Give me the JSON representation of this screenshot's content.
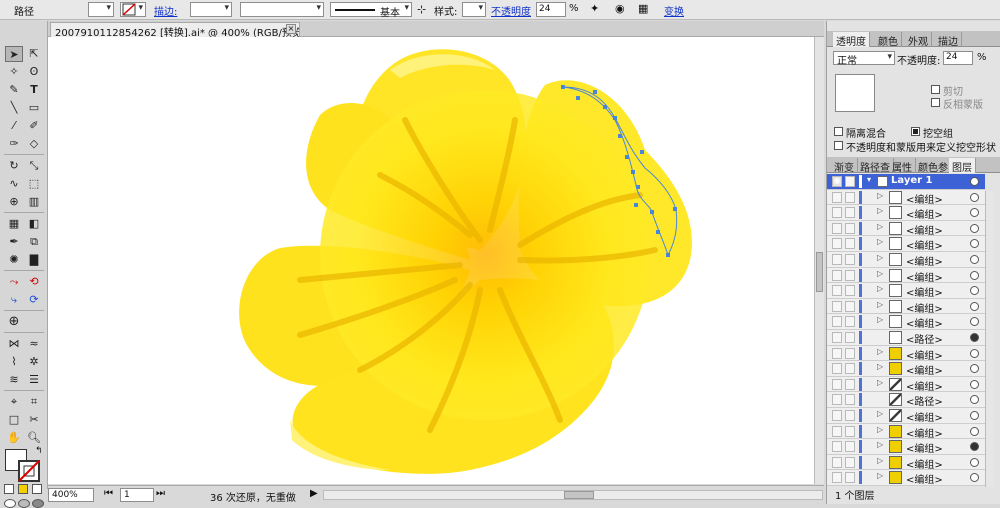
{
  "control_bar": {
    "object_type": "路径",
    "stroke_label": "描边:",
    "stroke_style_label": "基本",
    "style_label": "样式:",
    "opacity_label": "不透明度",
    "opacity_value": "24",
    "percent": "%",
    "transform_label": "变换"
  },
  "document_tab": {
    "title": "2007910112854262 [转换].ai* @ 400% (RGB/预览)",
    "close": "×"
  },
  "status_bar": {
    "zoom": "400%",
    "page": "1",
    "history": "36 次还原，无重做"
  },
  "transparency_panel": {
    "tabs": [
      "透明度",
      "颜色",
      "外观",
      "描边"
    ],
    "blend_mode": "正常",
    "opacity_label": "不透明度:",
    "opacity_value": "24",
    "percent": "%",
    "clip_label": "剪切",
    "invert_mask_label": "反相蒙版",
    "isolate_blending_label": "隔离混合",
    "knockout_group_label": "挖空组",
    "opacity_mask_define_label": "不透明度和蒙版用来定义挖空形状"
  },
  "layers_panel": {
    "tabs": [
      "渐变",
      "路径查",
      "属性",
      "颜色参",
      "图层"
    ],
    "layer_name": "Layer 1",
    "items": [
      {
        "name": "<编组>",
        "thumb": "blank",
        "filled": false
      },
      {
        "name": "<编组>",
        "thumb": "blank",
        "filled": false
      },
      {
        "name": "<编组>",
        "thumb": "blank",
        "filled": false
      },
      {
        "name": "<编组>",
        "thumb": "blank",
        "filled": false
      },
      {
        "name": "<编组>",
        "thumb": "blank",
        "filled": false
      },
      {
        "name": "<编组>",
        "thumb": "blank",
        "filled": false
      },
      {
        "name": "<编组>",
        "thumb": "blank",
        "filled": false
      },
      {
        "name": "<编组>",
        "thumb": "blank",
        "filled": false
      },
      {
        "name": "<编组>",
        "thumb": "blank",
        "filled": false
      },
      {
        "name": "<路径>",
        "thumb": "blank",
        "filled": true
      },
      {
        "name": "<编组>",
        "thumb": "yellow",
        "filled": false
      },
      {
        "name": "<编组>",
        "thumb": "yellow",
        "filled": false
      },
      {
        "name": "<编组>",
        "thumb": "stroke",
        "filled": false
      },
      {
        "name": "<路径>",
        "thumb": "stroke",
        "filled": false
      },
      {
        "name": "<编组>",
        "thumb": "stroke",
        "filled": false
      },
      {
        "name": "<编组>",
        "thumb": "yellow",
        "filled": false
      },
      {
        "name": "<编组>",
        "thumb": "yellow",
        "filled": true
      },
      {
        "name": "<编组>",
        "thumb": "yellow",
        "filled": false
      },
      {
        "name": "<编组>",
        "thumb": "yellow",
        "filled": false
      }
    ],
    "footer": "1 个图层"
  },
  "colors": {
    "petal": "#ffe81c",
    "petal_light": "#fff46a",
    "petal_dark": "#f5c700",
    "center": "#ffbf00",
    "vein": "#eab500",
    "selection": "#4a86d8",
    "layer_highlight": "#3c62d6"
  }
}
